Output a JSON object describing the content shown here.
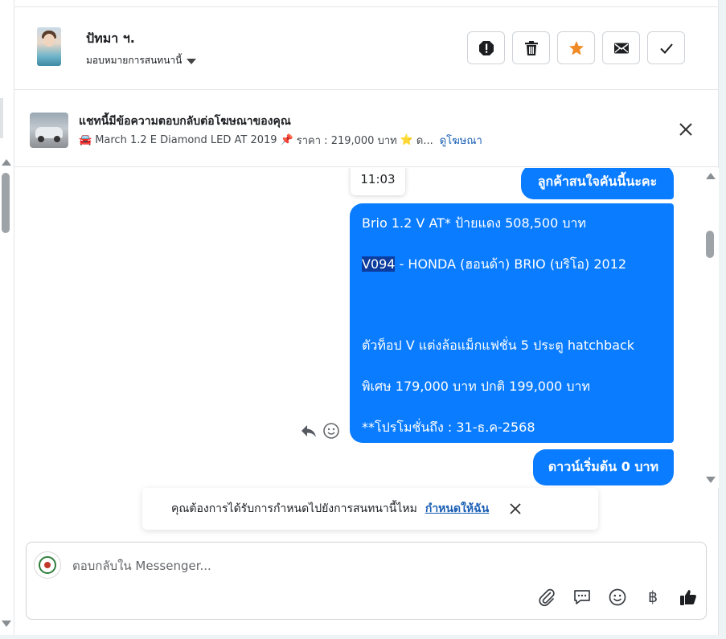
{
  "header": {
    "contact_name": "ปัทมา ฯ.",
    "assign_label": "มอบหมายการสนทนานี้"
  },
  "actions": [
    "spam-icon",
    "trash-icon",
    "star-icon",
    "mail-icon",
    "check-icon"
  ],
  "ad": {
    "title": "แชทนี้มีข้อความตอบกลับต่อโฆษณาของคุณ",
    "car_emoji": "🚘",
    "details": "March 1.2 E Diamond LED AT 2019",
    "pin_emoji": "📌",
    "price": "ราคา : 219,000 บาท",
    "star_emoji": "⭐",
    "more": "ด...",
    "view_ad": "ดูโฆษณา"
  },
  "chat": {
    "timestamp": "11:03",
    "messages": [
      "ลูกค้าสนใจคันนี้นะคะ",
      {
        "line1": "Brio 1.2 V AT* ป้ายแดง 508,500 บาท",
        "line2_code": "V094",
        "line2_rest": " - HONDA (ฮอนด้า) BRIO (บริโอ) 2012",
        "line3": "ตัวท็อป V แต่งล้อแม็กแฟชั่น 5 ประตู hatchback",
        "line4": "พิเศษ 179,000 บาท  ปกติ 199,000 บาท",
        "line5": "**โปรโมชั่นถึง : 31-ธ.ค-2568"
      },
      "ดาวน์เริ่มต้น 0 บาท"
    ]
  },
  "toast": {
    "question": "คุณต้องการได้รับการกำหนดไปยังการสนทนานี้ไหม",
    "cta": "กำหนดให้ฉัน"
  },
  "composer": {
    "placeholder": "ตอบกลับใน Messenger...",
    "baht_symbol": "฿"
  },
  "colors": {
    "bubble": "#0a7cff",
    "accent_star": "#f08a24",
    "link": "#1a5fb4"
  }
}
